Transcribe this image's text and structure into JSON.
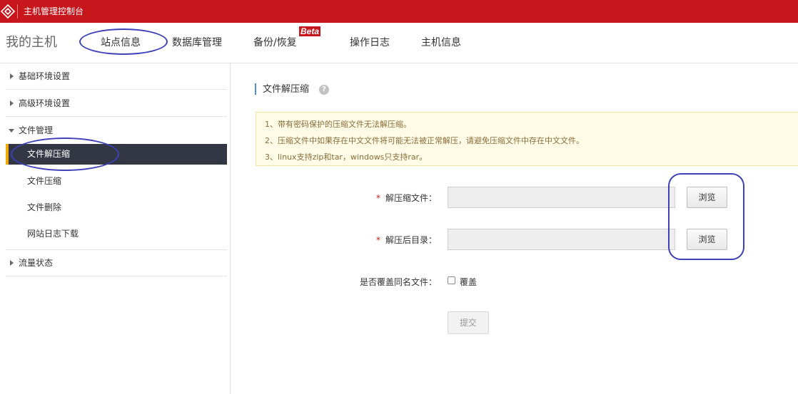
{
  "header": {
    "title": "主机管理控制台"
  },
  "nav": {
    "brand": "我的主机",
    "tabs": [
      {
        "label": "站点信息"
      },
      {
        "label": "数据库管理"
      },
      {
        "label": "备份/恢复",
        "badge": "Beta"
      },
      {
        "label": "操作日志"
      },
      {
        "label": "主机信息"
      }
    ]
  },
  "sidebar": {
    "sections": [
      {
        "label": "基础环境设置",
        "expanded": false
      },
      {
        "label": "高级环境设置",
        "expanded": false
      },
      {
        "label": "文件管理",
        "expanded": true
      },
      {
        "label": "流量状态",
        "expanded": false
      }
    ],
    "file_items": [
      {
        "label": "文件解压缩",
        "active": true
      },
      {
        "label": "文件压缩"
      },
      {
        "label": "文件删除"
      },
      {
        "label": "网站日志下载"
      }
    ]
  },
  "main": {
    "title": "文件解压缩",
    "notices": [
      "1、带有密码保护的压缩文件无法解压缩。",
      "2、压缩文件中如果存在中文文件将可能无法被正常解压，请避免压缩文件中存在中文文件。",
      "3、linux支持zip和tar，windows只支持rar。"
    ],
    "form": {
      "required_mark": "*",
      "archive_label": "解压缩文件：",
      "archive_value": "",
      "target_label": "解压后目录：",
      "target_value": "",
      "browse_label": "浏览",
      "overwrite_label": "是否覆盖同名文件：",
      "overwrite_option": "覆盖",
      "overwrite_checked": false,
      "submit_label": "提交"
    }
  },
  "colors": {
    "brand_red": "#c8161d",
    "active_item_bg": "#333743",
    "active_item_bar": "#f0a900",
    "notice_bg": "#fffbe6",
    "annotation": "#3d40b8"
  }
}
